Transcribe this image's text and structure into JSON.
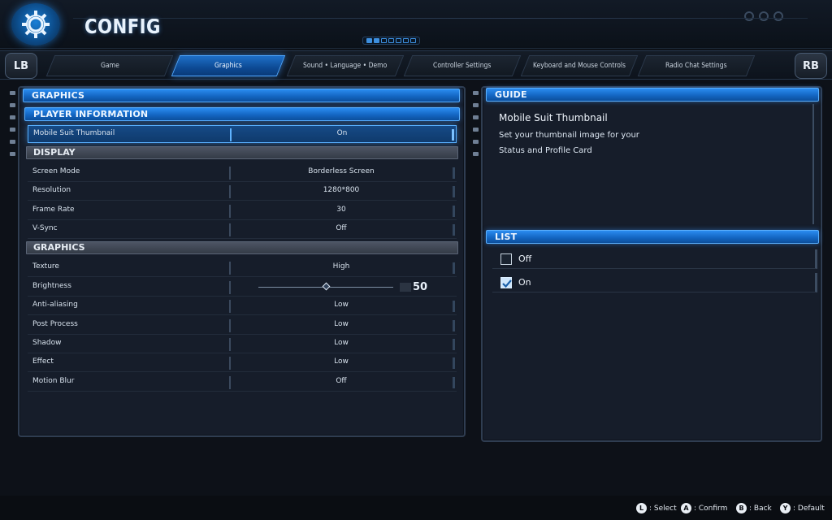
{
  "app": {
    "title": "CONFIG",
    "accent": "#1e7fe0"
  },
  "header": {
    "icon": "gear-icon",
    "page_indicator": {
      "current": 2,
      "total": 7
    }
  },
  "tabs": {
    "left_bumper": "LB",
    "right_bumper": "RB",
    "items": [
      {
        "label": "Game"
      },
      {
        "label": "Graphics",
        "active": true
      },
      {
        "label": "Sound • Language • Demo"
      },
      {
        "label": "Controller Settings"
      },
      {
        "label": "Keyboard and Mouse Controls"
      },
      {
        "label": "Radio Chat Settings"
      }
    ]
  },
  "settings": {
    "header": "GRAPHICS",
    "player_info": {
      "header": "PLAYER INFORMATION",
      "rows": [
        {
          "label": "Mobile Suit Thumbnail",
          "value": "On"
        }
      ]
    },
    "display": {
      "header": "DISPLAY",
      "rows": [
        {
          "label": "Screen Mode",
          "value": "Borderless Screen"
        },
        {
          "label": "Resolution",
          "value": "1280*800"
        },
        {
          "label": "Frame Rate",
          "value": "30"
        },
        {
          "label": "V-Sync",
          "value": "Off"
        }
      ]
    },
    "graphics": {
      "header": "GRAPHICS",
      "rows": [
        {
          "label": "Texture",
          "value": "High"
        },
        {
          "label": "Brightness",
          "value": "50",
          "slider_fraction": 0.5
        },
        {
          "label": "Anti-aliasing",
          "value": "Low"
        },
        {
          "label": "Post Process",
          "value": "Low"
        },
        {
          "label": "Shadow",
          "value": "Low"
        },
        {
          "label": "Effect",
          "value": "Low"
        },
        {
          "label": "Motion Blur",
          "value": "Off"
        }
      ]
    }
  },
  "guide": {
    "header": "GUIDE",
    "title": "Mobile Suit Thumbnail",
    "line1": "Set your thumbnail image for your",
    "line2": "Status and Profile Card"
  },
  "list": {
    "header": "LIST",
    "options": [
      {
        "label": "Off",
        "checked": false
      },
      {
        "label": "On",
        "checked": true
      }
    ]
  },
  "footer": {
    "hints": [
      {
        "button": "L",
        "label": ": Select"
      },
      {
        "button": "A",
        "label": ": Confirm"
      },
      {
        "button": "B",
        "label": ": Back"
      },
      {
        "button": "Y",
        "label": ": Default"
      }
    ]
  }
}
